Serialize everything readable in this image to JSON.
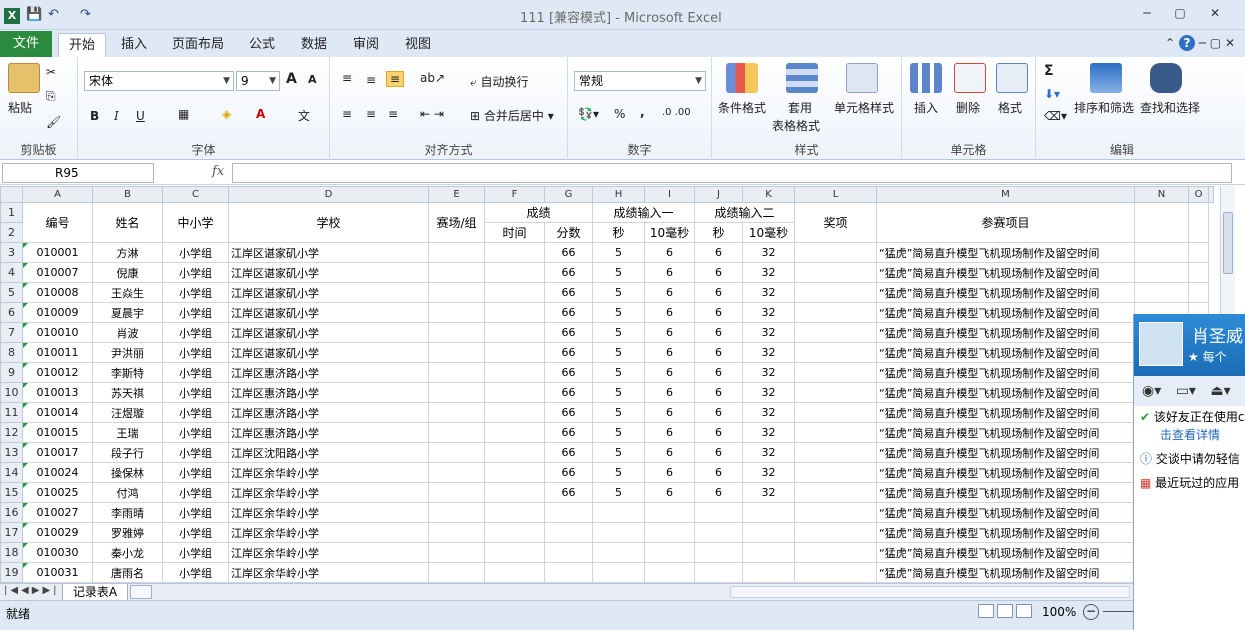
{
  "window": {
    "title": "111  [兼容模式]  -  Microsoft Excel",
    "app_icon": "X",
    "qat_save": "💾",
    "qat_undo": "↶",
    "qat_redo": "↷",
    "min": "─",
    "max": "▢",
    "close": "✕"
  },
  "tabs": {
    "file": "文件",
    "items": [
      "开始",
      "插入",
      "页面布局",
      "公式",
      "数据",
      "审阅",
      "视图"
    ],
    "help": "?"
  },
  "ribbon": {
    "clipboard": {
      "paste": "粘贴",
      "label": "剪贴板"
    },
    "font": {
      "name": "宋体",
      "size": "9",
      "bold": "B",
      "italic": "I",
      "underline": "U",
      "grow": "A",
      "shrink": "A",
      "label": "字体"
    },
    "alignment": {
      "wrap": "自动换行",
      "merge": "合并后居中",
      "label": "对齐方式"
    },
    "number": {
      "format": "常规",
      "percent": "%",
      "comma": ",",
      "label": "数字"
    },
    "styles": {
      "cond": "条件格式",
      "table1": "套用",
      "table2": "表格格式",
      "cell": "单元格样式",
      "label": "样式"
    },
    "cells": {
      "insert": "插入",
      "delete": "删除",
      "format": "格式",
      "label": "单元格"
    },
    "editing": {
      "sum": "Σ",
      "sort": "排序和筛选",
      "find": "查找和选择",
      "label": "编辑"
    }
  },
  "formula_bar": {
    "name_box": "R95",
    "fx": "fx",
    "formula": ""
  },
  "columns": [
    "A",
    "B",
    "C",
    "D",
    "E",
    "F",
    "G",
    "H",
    "I",
    "J",
    "K",
    "L",
    "M",
    "N",
    "O"
  ],
  "headers": {
    "bianhao": "编号",
    "xingming": "姓名",
    "zhongxiaoxue": "中小学",
    "xuexiao": "学校",
    "saichang": "赛场/组",
    "chengji": "成绩",
    "shuru1": "成绩输入一",
    "shuru2": "成绩输入二",
    "jiangxiang": "奖项",
    "canxiang": "参赛项目",
    "shijian": "时间",
    "fenshu": "分数",
    "miao1": "秒",
    "haomiao1": "10毫秒",
    "miao2": "秒",
    "haomiao2": "10毫秒"
  },
  "rows": [
    {
      "r": "3",
      "id": "010001",
      "name": "方淋",
      "level": "小学组",
      "school": "江岸区谌家矶小学",
      "score": "66",
      "s1": "5",
      "ms1": "6",
      "s2": "6",
      "ms2": "32",
      "project": "“猛虎”简易直升模型飞机现场制作及留空时间"
    },
    {
      "r": "4",
      "id": "010007",
      "name": "倪康",
      "level": "小学组",
      "school": "江岸区谌家矶小学",
      "score": "66",
      "s1": "5",
      "ms1": "6",
      "s2": "6",
      "ms2": "32",
      "project": "“猛虎”简易直升模型飞机现场制作及留空时间"
    },
    {
      "r": "5",
      "id": "010008",
      "name": "王焱生",
      "level": "小学组",
      "school": "江岸区谌家矶小学",
      "score": "66",
      "s1": "5",
      "ms1": "6",
      "s2": "6",
      "ms2": "32",
      "project": "“猛虎”简易直升模型飞机现场制作及留空时间"
    },
    {
      "r": "6",
      "id": "010009",
      "name": "夏晨宇",
      "level": "小学组",
      "school": "江岸区谌家矶小学",
      "score": "66",
      "s1": "5",
      "ms1": "6",
      "s2": "6",
      "ms2": "32",
      "project": "“猛虎”简易直升模型飞机现场制作及留空时间"
    },
    {
      "r": "7",
      "id": "010010",
      "name": "肖波",
      "level": "小学组",
      "school": "江岸区谌家矶小学",
      "score": "66",
      "s1": "5",
      "ms1": "6",
      "s2": "6",
      "ms2": "32",
      "project": "“猛虎”简易直升模型飞机现场制作及留空时间"
    },
    {
      "r": "8",
      "id": "010011",
      "name": "尹洪丽",
      "level": "小学组",
      "school": "江岸区谌家矶小学",
      "score": "66",
      "s1": "5",
      "ms1": "6",
      "s2": "6",
      "ms2": "32",
      "project": "“猛虎”简易直升模型飞机现场制作及留空时间"
    },
    {
      "r": "9",
      "id": "010012",
      "name": "李斯特",
      "level": "小学组",
      "school": "江岸区惠济路小学",
      "score": "66",
      "s1": "5",
      "ms1": "6",
      "s2": "6",
      "ms2": "32",
      "project": "“猛虎”简易直升模型飞机现场制作及留空时间"
    },
    {
      "r": "10",
      "id": "010013",
      "name": "苏天祺",
      "level": "小学组",
      "school": "江岸区惠济路小学",
      "score": "66",
      "s1": "5",
      "ms1": "6",
      "s2": "6",
      "ms2": "32",
      "project": "“猛虎”简易直升模型飞机现场制作及留空时间"
    },
    {
      "r": "11",
      "id": "010014",
      "name": "汪煜璇",
      "level": "小学组",
      "school": "江岸区惠济路小学",
      "score": "66",
      "s1": "5",
      "ms1": "6",
      "s2": "6",
      "ms2": "32",
      "project": "“猛虎”简易直升模型飞机现场制作及留空时间"
    },
    {
      "r": "12",
      "id": "010015",
      "name": "王瑞",
      "level": "小学组",
      "school": "江岸区惠济路小学",
      "score": "66",
      "s1": "5",
      "ms1": "6",
      "s2": "6",
      "ms2": "32",
      "project": "“猛虎”简易直升模型飞机现场制作及留空时间"
    },
    {
      "r": "13",
      "id": "010017",
      "name": "段子行",
      "level": "小学组",
      "school": "江岸区沈阳路小学",
      "score": "66",
      "s1": "5",
      "ms1": "6",
      "s2": "6",
      "ms2": "32",
      "project": "“猛虎”简易直升模型飞机现场制作及留空时间"
    },
    {
      "r": "14",
      "id": "010024",
      "name": "操保林",
      "level": "小学组",
      "school": "江岸区余华岭小学",
      "score": "66",
      "s1": "5",
      "ms1": "6",
      "s2": "6",
      "ms2": "32",
      "project": "“猛虎”简易直升模型飞机现场制作及留空时间"
    },
    {
      "r": "15",
      "id": "010025",
      "name": "付鸿",
      "level": "小学组",
      "school": "江岸区余华岭小学",
      "score": "66",
      "s1": "5",
      "ms1": "6",
      "s2": "6",
      "ms2": "32",
      "project": "“猛虎”简易直升模型飞机现场制作及留空时间"
    },
    {
      "r": "16",
      "id": "010027",
      "name": "李雨晴",
      "level": "小学组",
      "school": "江岸区余华岭小学",
      "score": "",
      "s1": "",
      "ms1": "",
      "s2": "",
      "ms2": "",
      "project": "“猛虎”简易直升模型飞机现场制作及留空时间"
    },
    {
      "r": "17",
      "id": "010029",
      "name": "罗雅婷",
      "level": "小学组",
      "school": "江岸区余华岭小学",
      "score": "",
      "s1": "",
      "ms1": "",
      "s2": "",
      "ms2": "",
      "project": "“猛虎”简易直升模型飞机现场制作及留空时间"
    },
    {
      "r": "18",
      "id": "010030",
      "name": "秦小龙",
      "level": "小学组",
      "school": "江岸区余华岭小学",
      "score": "",
      "s1": "",
      "ms1": "",
      "s2": "",
      "ms2": "",
      "project": "“猛虎”简易直升模型飞机现场制作及留空时间"
    },
    {
      "r": "19",
      "id": "010031",
      "name": "唐雨名",
      "level": "小学组",
      "school": "江岸区余华岭小学",
      "score": "",
      "s1": "",
      "ms1": "",
      "s2": "",
      "ms2": "",
      "project": "“猛虎”简易直升模型飞机现场制作及留空时间"
    }
  ],
  "sheet_tab": "记录表A",
  "status": {
    "ready": "就绪",
    "zoom": "100%",
    "zoom_minus": "−"
  },
  "qq": {
    "name": "肖圣威",
    "sub": "每个",
    "line1": "该好友正在使用c",
    "link": "击查看详情",
    "line2": "交谈中请勿轻信",
    "line3": "最近玩过的应用"
  }
}
